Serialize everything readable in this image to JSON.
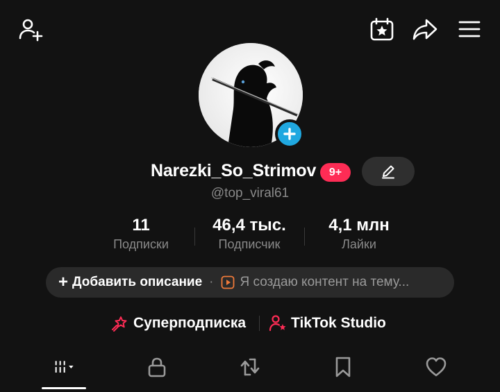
{
  "top_bar": {
    "icons": [
      "add-friend-icon",
      "calendar-star-icon",
      "share-icon",
      "menu-icon"
    ]
  },
  "profile": {
    "username": "Narezki_So_Strimov",
    "badge": "9+",
    "handle": "@top_viral61"
  },
  "stats": [
    {
      "value": "11",
      "label": "Подписки"
    },
    {
      "value": "46,4 тыс.",
      "label": "Подписчик"
    },
    {
      "value": "4,1 млн",
      "label": "Лайки"
    }
  ],
  "description": {
    "add_label": "Добавить описание",
    "separator": "·",
    "text": "Я создаю контент на тему..."
  },
  "links": [
    {
      "label": "Суперподписка",
      "icon": "super-subscription-icon"
    },
    {
      "label": "TikTok Studio",
      "icon": "tiktok-studio-icon"
    }
  ],
  "tabs": [
    "videos-grid-icon",
    "lock-icon",
    "repost-icon",
    "bookmark-icon",
    "heart-icon"
  ],
  "colors": {
    "background": "#121212",
    "accent_red": "#fe2c55",
    "accent_blue": "#20a8e0",
    "pill": "#2a2a2a",
    "muted_text": "#8a8a8a"
  }
}
